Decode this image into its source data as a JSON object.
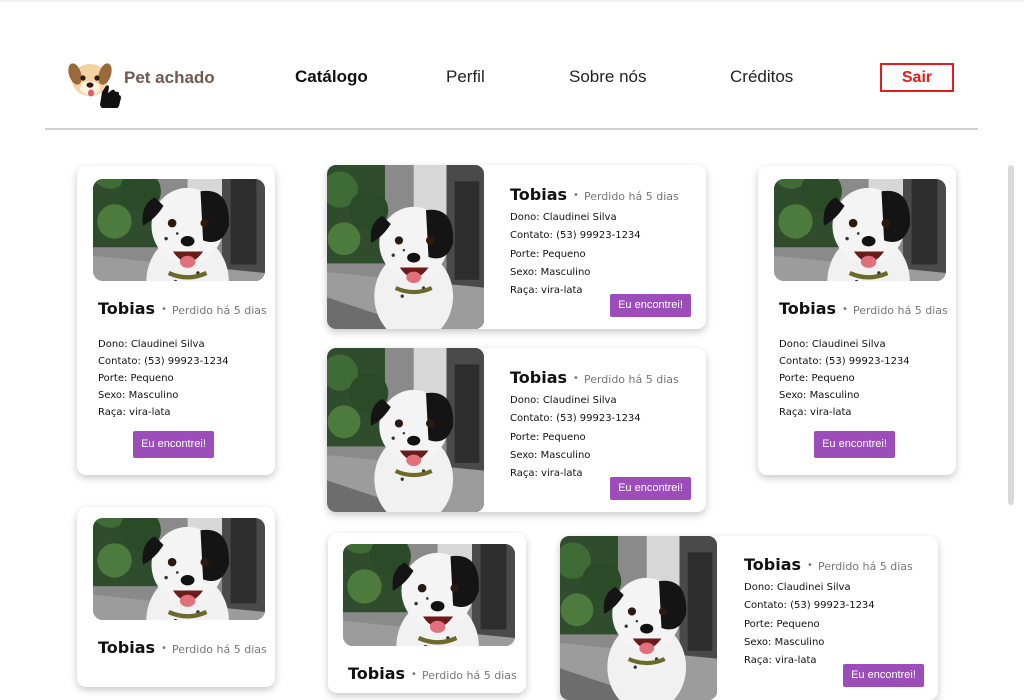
{
  "header": {
    "brand": "Pet achado",
    "nav": [
      "Catálogo",
      "Perfil",
      "Sobre nós",
      "Créditos"
    ],
    "logout": "Sair"
  },
  "pet": {
    "name": "Tobias",
    "status": "Perdido há 5 dias",
    "owner": "Dono: Claudinei Silva",
    "contact": "Contato: (53) 99923-1234",
    "size": "Porte: Pequeno",
    "sex": "Sexo: Masculino",
    "breed": "Raça: vira-lata",
    "found_button": "Eu encontrei!"
  },
  "colors": {
    "accent": "#9c4dba",
    "logout": "#e51c1c",
    "brand": "#6e5a50"
  },
  "icons": {
    "logo": "dog-hand-logo-icon"
  }
}
